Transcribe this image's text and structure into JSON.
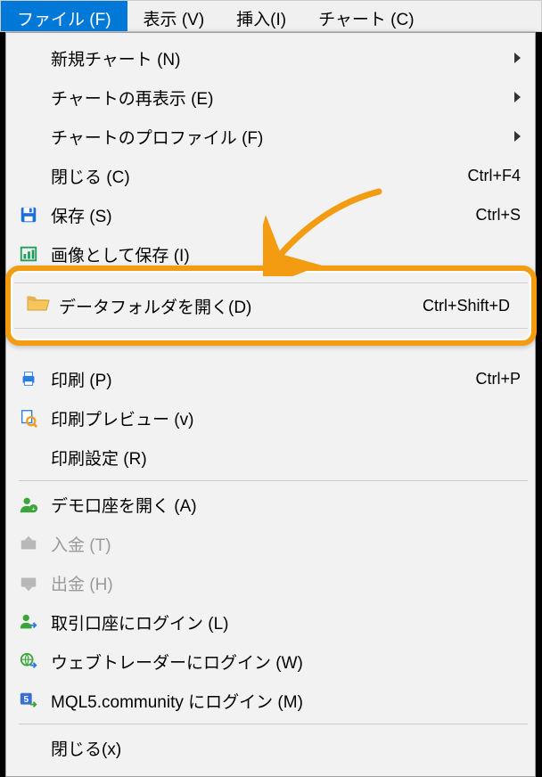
{
  "menubar": {
    "file": "ファイル (F)",
    "view": "表示 (V)",
    "insert": "挿入(I)",
    "chart": "チャート (C)"
  },
  "menu": {
    "new_chart": "新規チャート (N)",
    "reshow_chart": "チャートの再表示 (E)",
    "chart_profile": "チャートのプロファイル (F)",
    "close": "閉じる (C)",
    "close_sc": "Ctrl+F4",
    "save": "保存 (S)",
    "save_sc": "Ctrl+S",
    "save_image": "画像として保存 (I)",
    "open_data_folder": "データフォルダを開く(D)",
    "open_data_folder_sc": "Ctrl+Shift+D",
    "print": "印刷 (P)",
    "print_sc": "Ctrl+P",
    "print_preview": "印刷プレビュー (v)",
    "print_setup": "印刷設定 (R)",
    "open_demo": "デモ口座を開く (A)",
    "deposit": "入金 (T)",
    "withdraw": "出金 (H)",
    "login_trade": "取引口座にログイン (L)",
    "login_web": "ウェブトレーダーにログイン (W)",
    "login_mql5": "MQL5.community にログイン (M)",
    "close2": "閉じる(x)"
  }
}
